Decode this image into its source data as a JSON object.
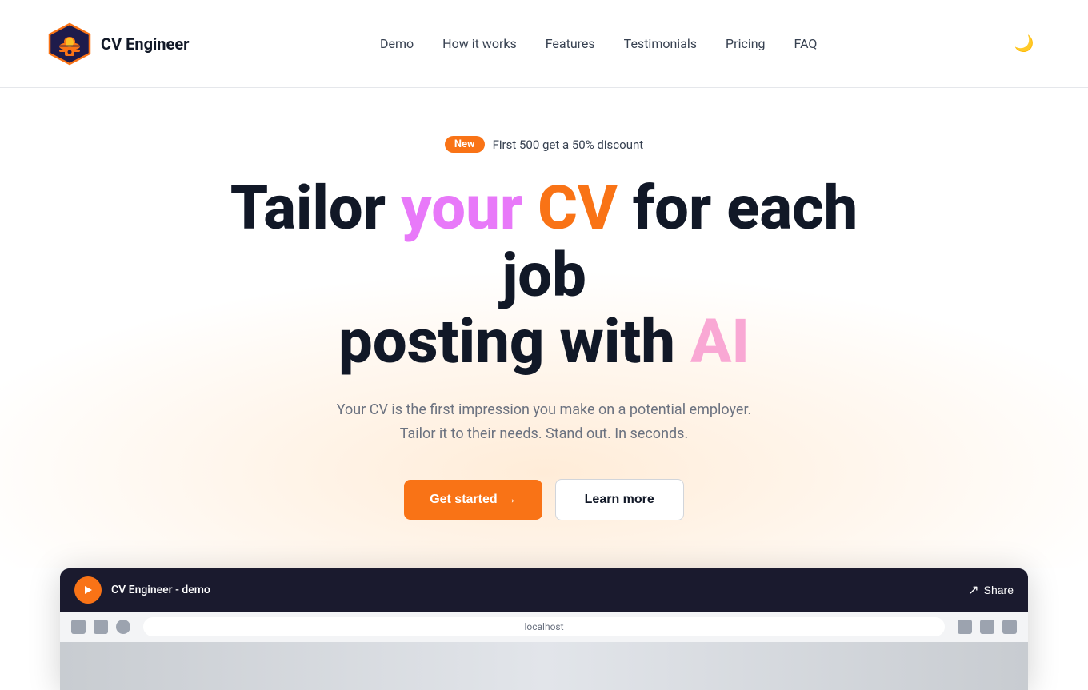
{
  "brand": {
    "name": "CV Engineer",
    "logo_alt": "CV Engineer logo"
  },
  "nav": {
    "links": [
      {
        "label": "Demo",
        "href": "#"
      },
      {
        "label": "How it works",
        "href": "#"
      },
      {
        "label": "Features",
        "href": "#"
      },
      {
        "label": "Testimonials",
        "href": "#"
      },
      {
        "label": "Pricing",
        "href": "#"
      },
      {
        "label": "FAQ",
        "href": "#"
      }
    ],
    "dark_mode_icon": "🌙"
  },
  "hero": {
    "badge_new": "New",
    "badge_message": "First 500 get a 50% discount",
    "heading_part1": "Tailor ",
    "heading_your": "your",
    "heading_space1": " ",
    "heading_cv": "CV",
    "heading_part2": " for each job posting with ",
    "heading_ai": "AI",
    "subtext_line1": "Your CV is the first impression you make on a potential employer.",
    "subtext_line2": "Tailor it to their needs. Stand out. In seconds.",
    "btn_primary": "Get started",
    "btn_primary_arrow": "→",
    "btn_secondary": "Learn more"
  },
  "video": {
    "title": "CV Engineer - demo",
    "share_label": "Share",
    "url_bar": "localhost"
  }
}
